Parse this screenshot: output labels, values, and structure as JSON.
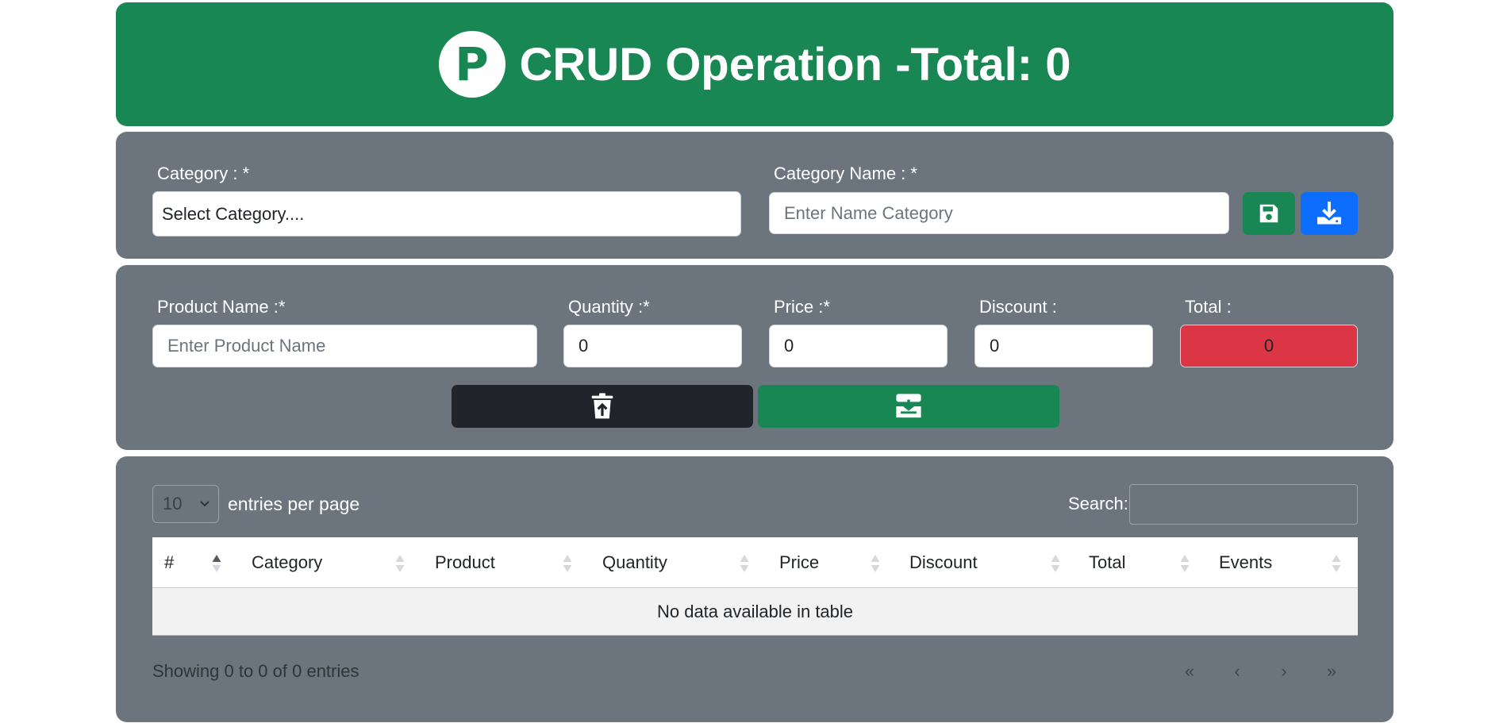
{
  "header": {
    "logo_letter": "P",
    "title": "CRUD Operation -Total: 0"
  },
  "category_form": {
    "category_label": "Category : *",
    "category_select_value": "Select Category....",
    "category_name_label": "Category Name : *",
    "category_name_placeholder": "Enter Name Category",
    "save_icon": "floppy-disk-icon",
    "download_icon": "download-icon"
  },
  "product_form": {
    "product_name_label": "Product Name :*",
    "product_name_placeholder": "Enter Product Name",
    "quantity_label": "Quantity :*",
    "quantity_value": "0",
    "price_label": "Price :*",
    "price_value": "0",
    "discount_label": "Discount :",
    "discount_value": "0",
    "total_label": "Total :",
    "total_value": "0",
    "delete_icon": "trash-upload-icon",
    "submit_icon": "inbox-download-icon"
  },
  "table": {
    "entries_value": "10",
    "entries_label": "entries per page",
    "search_label": "Search:",
    "columns": [
      "#",
      "Category",
      "Product",
      "Quantity",
      "Price",
      "Discount",
      "Total",
      "Events"
    ],
    "empty_message": "No data available in table",
    "info": "Showing 0 to 0 of 0 entries",
    "pagination": [
      "«",
      "‹",
      "›",
      "»"
    ]
  },
  "colors": {
    "header_green": "#198754",
    "panel_gray": "#6c757d",
    "primary_blue": "#0d6efd",
    "danger_red": "#dc3545",
    "dark": "#212529"
  }
}
